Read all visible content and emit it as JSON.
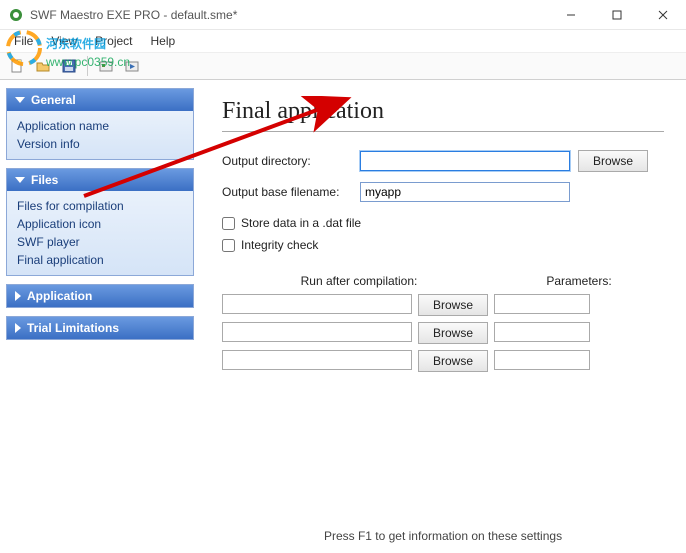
{
  "window": {
    "title": "SWF Maestro EXE PRO - default.sme*"
  },
  "menu": {
    "items": [
      "File",
      "View",
      "Project",
      "Help"
    ]
  },
  "sidebar": {
    "general": {
      "title": "General",
      "items": [
        "Application name",
        "Version info"
      ]
    },
    "files": {
      "title": "Files",
      "items": [
        "Files for compilation",
        "Application icon",
        "SWF player",
        "Final application"
      ]
    },
    "application": {
      "title": "Application"
    },
    "trial": {
      "title": "Trial Limitations"
    }
  },
  "main": {
    "heading": "Final application",
    "output_dir_label": "Output directory:",
    "output_dir_value": "",
    "browse_label": "Browse",
    "base_filename_label": "Output base filename:",
    "base_filename_value": "myapp",
    "store_dat_label": "Store data in a .dat file",
    "integrity_label": "Integrity check",
    "run_after_label": "Run after compilation:",
    "parameters_label": "Parameters:",
    "run_rows": [
      {
        "cmd": "",
        "params": ""
      },
      {
        "cmd": "",
        "params": ""
      },
      {
        "cmd": "",
        "params": ""
      }
    ]
  },
  "status": {
    "text": "Press F1 to get information on these settings"
  },
  "watermark": {
    "text_cn": "河东软件园",
    "text_url": "www.pc0359.cn"
  }
}
